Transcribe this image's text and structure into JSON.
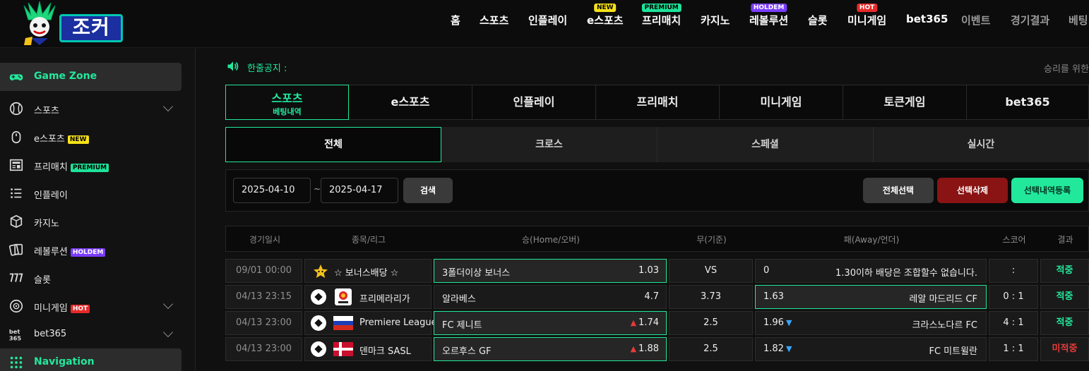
{
  "brand": {
    "logo_text": "조커"
  },
  "nav": [
    {
      "label": "홈"
    },
    {
      "label": "스포츠"
    },
    {
      "label": "인플레이"
    },
    {
      "label": "e스포츠",
      "badge": "NEW"
    },
    {
      "label": "프리매치",
      "badge": "PREMIUM"
    },
    {
      "label": "카지노"
    },
    {
      "label": "레볼루션",
      "badge": "HOLDEM"
    },
    {
      "label": "슬롯"
    },
    {
      "label": "미니게임",
      "badge": "HOT"
    },
    {
      "label": "bet365"
    },
    {
      "label": "이벤트"
    },
    {
      "label": "경기결과"
    },
    {
      "label": "베팅"
    }
  ],
  "sidebar": {
    "zone_label": "Game Zone",
    "items": [
      {
        "label": "스포츠",
        "icon": "baseball-icon"
      },
      {
        "label": "e스포츠",
        "badge": "NEW",
        "icon": "mouse-icon"
      },
      {
        "label": "프리매치",
        "badge": "PREMIUM",
        "icon": "newspaper-icon"
      },
      {
        "label": "인플레이",
        "icon": "list-icon"
      },
      {
        "label": "카지노",
        "icon": "dice-icon"
      },
      {
        "label": "레볼루션",
        "badge": "HOLDEM",
        "icon": "cards-icon"
      },
      {
        "label": "슬롯",
        "icon": "slot-777-icon"
      },
      {
        "label": "미니게임",
        "badge": "HOT",
        "icon": "ball-icon"
      },
      {
        "label": "bet365",
        "icon": "bet365-icon"
      }
    ],
    "nav_label": "Navigation"
  },
  "notice": {
    "label": "한줄공지 :",
    "text": "승리를 위한"
  },
  "main_tabs": [
    {
      "label": "스포츠",
      "sub": "베팅내역"
    },
    {
      "label": "e스포츠"
    },
    {
      "label": "인플레이"
    },
    {
      "label": "프리매치"
    },
    {
      "label": "미니게임"
    },
    {
      "label": "토큰게임"
    },
    {
      "label": "bet365"
    }
  ],
  "sub_tabs": [
    "전체",
    "크로스",
    "스페셜",
    "실시간"
  ],
  "filter": {
    "date_from": "2025-04-10",
    "date_sep": "~",
    "date_to": "2025-04-17",
    "search_label": "검색",
    "select_all_label": "전체선택",
    "delete_label": "선택삭제",
    "register_label": "선택내역등록"
  },
  "table": {
    "headers": [
      "경기일시",
      "종목/리그",
      "승(Home/오버)",
      "무(기준)",
      "패(Away/언더)",
      "스코어",
      "결과"
    ],
    "rows": [
      {
        "date": "09/01 00:00",
        "league": "☆ 보너스배당 ☆",
        "home": "3폴더이상 보너스",
        "home_odds": "1.03",
        "draw": "VS",
        "away_odds": "0",
        "away": "1.30이하 배당은 조합할수 없습니다.",
        "score": ":",
        "result": "적중"
      },
      {
        "date": "04/13 23:15",
        "league": "프리메라리가",
        "home": "알라베스",
        "home_odds": "4.7",
        "draw": "3.73",
        "away_odds": "1.63",
        "away": "레알 마드리드 CF",
        "score": "0 : 1",
        "result": "적중"
      },
      {
        "date": "04/13 23:00",
        "league": "Premiere League",
        "home": "FC 제니트",
        "home_odds": "1.74",
        "draw": "2.5",
        "away_odds": "1.96",
        "away": "크라스노다르 FC",
        "score": "4 : 1",
        "result": "적중"
      },
      {
        "date": "04/13 23:00",
        "league": "덴마크 SASL",
        "home": "오르후스 GF",
        "home_odds": "1.88",
        "draw": "2.5",
        "away_odds": "1.82",
        "away": "FC 미트윌란",
        "score": "1 : 1",
        "result": "미적중"
      }
    ]
  },
  "colors": {
    "accent": "#22e89c",
    "danger": "#e83a3a",
    "delete_btn": "#8a1414"
  }
}
